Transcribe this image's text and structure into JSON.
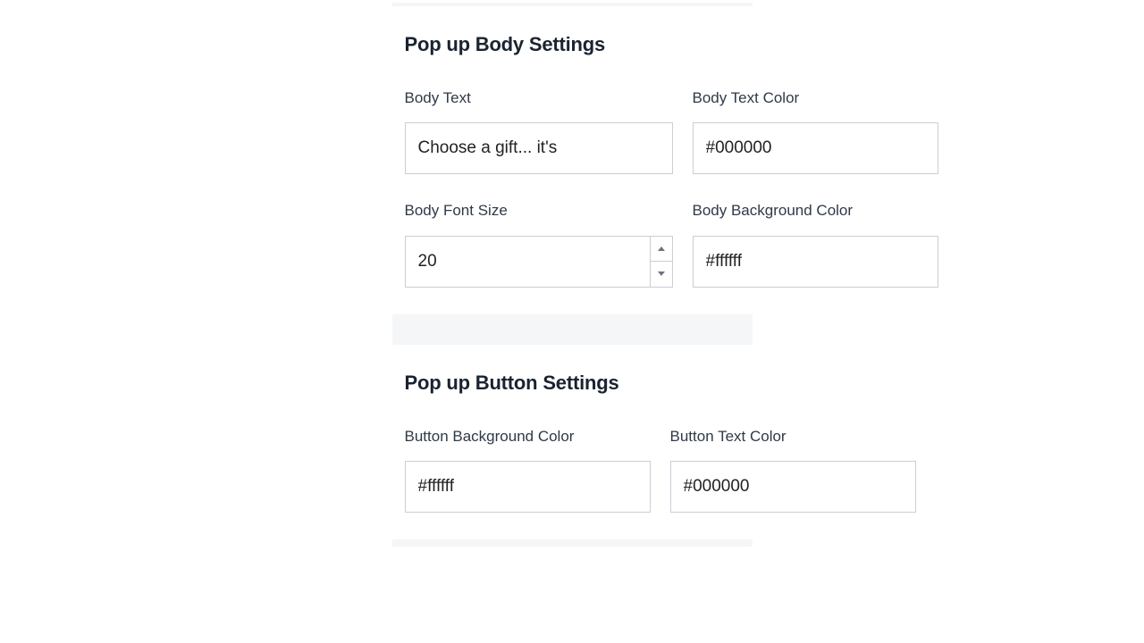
{
  "body_settings": {
    "title": "Pop up Body Settings",
    "body_text": {
      "label": "Body Text",
      "value": "Choose a gift... it's"
    },
    "body_text_color": {
      "label": "Body Text Color",
      "value": "#000000"
    },
    "body_font_size": {
      "label": "Body Font Size",
      "value": "20"
    },
    "body_bg_color": {
      "label": "Body Background Color",
      "value": "#ffffff"
    }
  },
  "button_settings": {
    "title": "Pop up Button Settings",
    "button_bg_color": {
      "label": "Button Background Color",
      "value": "#ffffff"
    },
    "button_text_color": {
      "label": "Button Text Color",
      "value": "#000000"
    }
  }
}
